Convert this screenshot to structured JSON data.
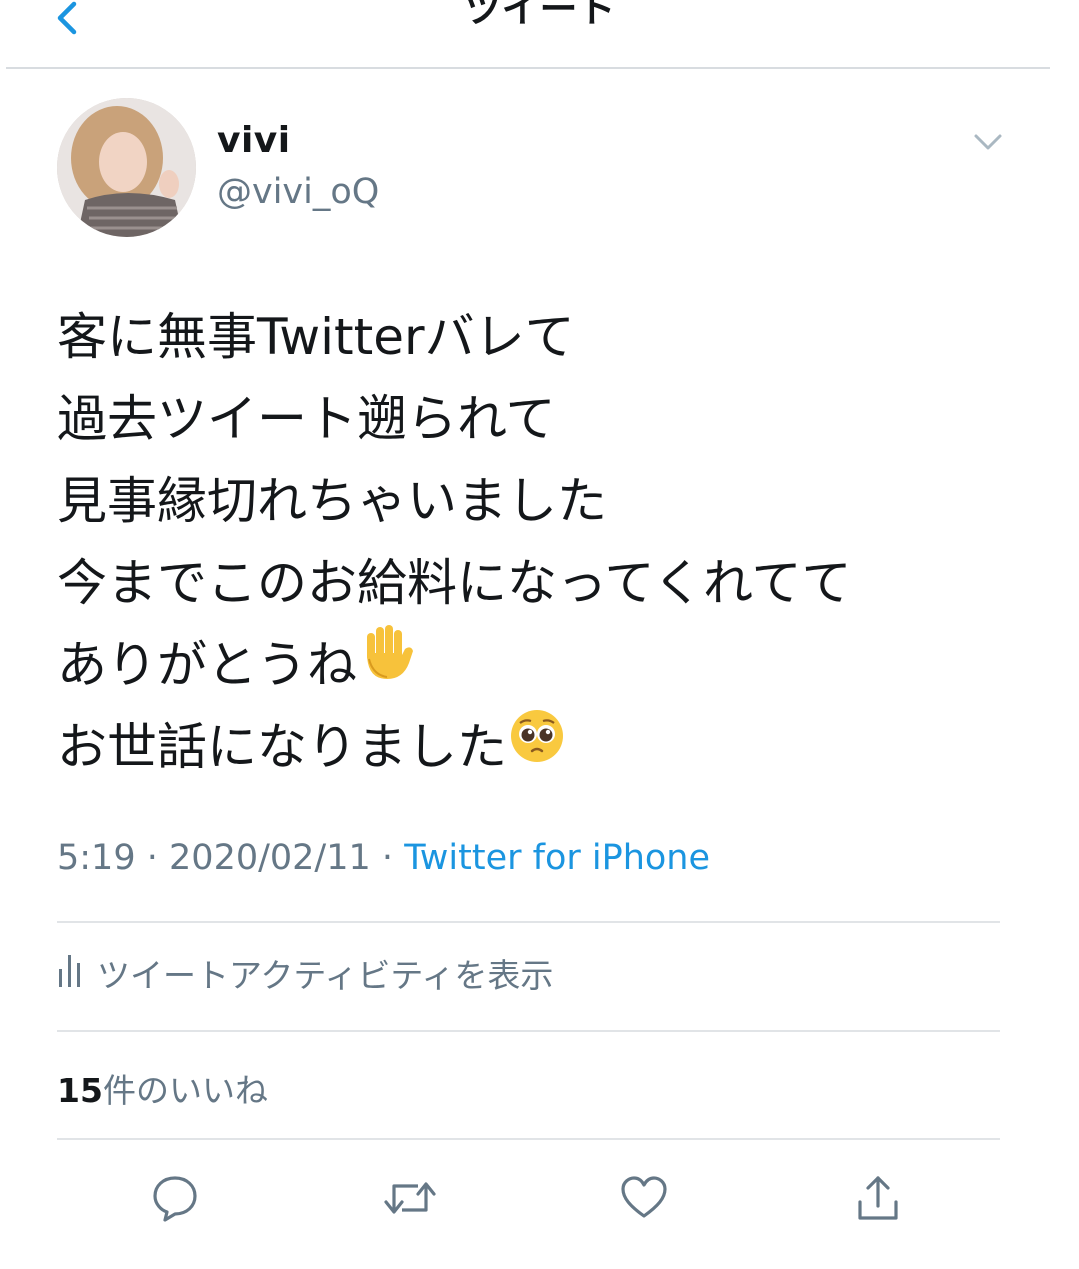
{
  "header": {
    "title": "ツイート",
    "back_icon": "chevron-left-icon"
  },
  "tweet": {
    "author_name": "vivi",
    "author_handle": "@vivi_oQ",
    "lines": [
      "客に無事Twitterバレて",
      "過去ツイート遡られて",
      "見事縁切れちゃいました",
      "今までこのお給料になってくれてて",
      "ありがとうね",
      "お世話になりました"
    ],
    "line5_emoji": "raised-hand-emoji",
    "line6_emoji": "pleading-face-emoji",
    "time": "5:19",
    "date": "2020/02/11",
    "separator": "·",
    "source": "Twitter for iPhone"
  },
  "activity": {
    "label": "ツイートアクティビティを表示",
    "icon": "bar-chart-icon"
  },
  "likes": {
    "count": "15",
    "label": "件のいいね"
  },
  "actions": {
    "reply_icon": "reply-icon",
    "retweet_icon": "retweet-icon",
    "like_icon": "heart-icon",
    "share_icon": "share-icon"
  },
  "colors": {
    "link": "#1b95e0",
    "secondary_text": "#657786",
    "primary_text": "#14171a",
    "divider": "#e1e4e7"
  }
}
